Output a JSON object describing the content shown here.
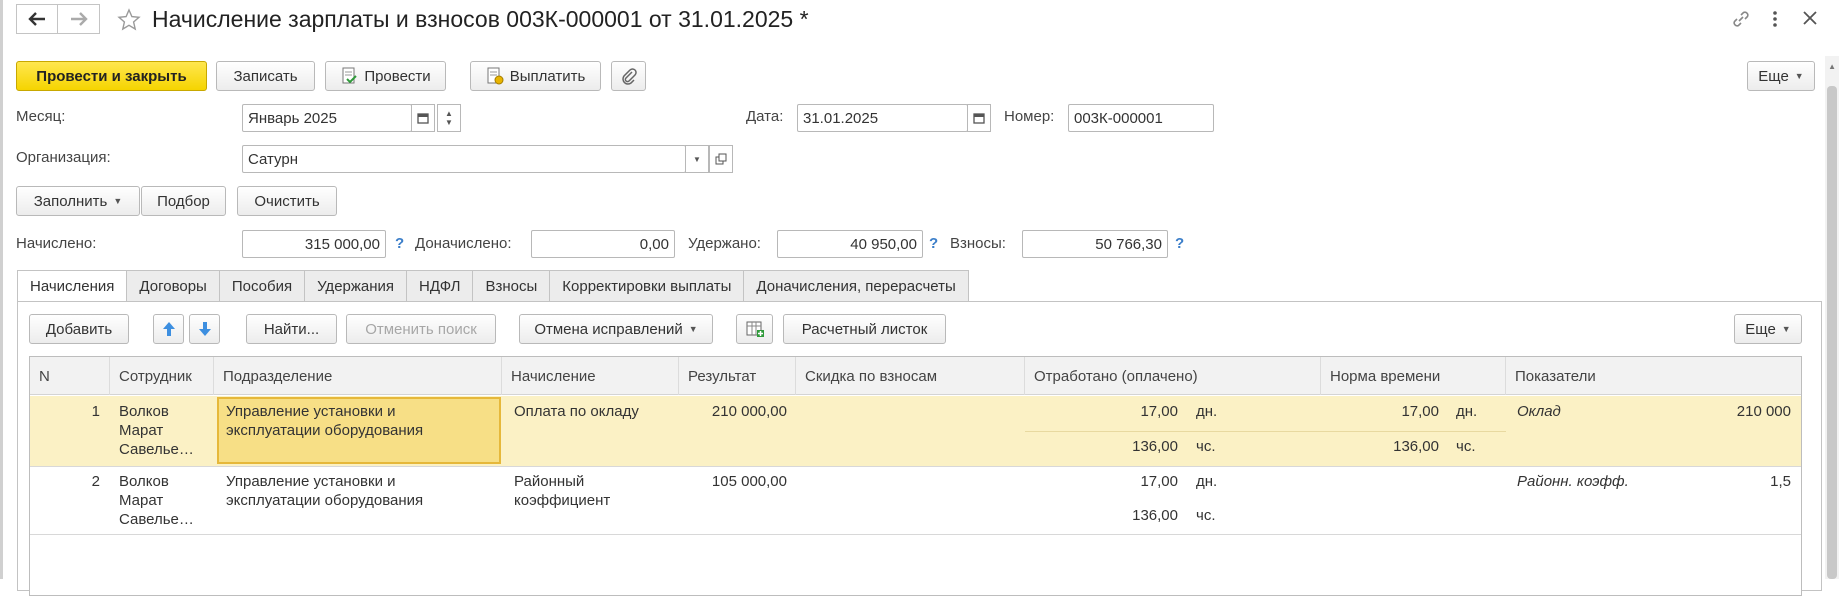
{
  "header": {
    "title": "Начисление зарплаты и взносов 003К-000001 от 31.01.2025 *"
  },
  "toolbar": {
    "post_close": "Провести и закрыть",
    "save": "Записать",
    "post": "Провести",
    "pay": "Выплатить",
    "more": "Еще"
  },
  "form": {
    "month_label": "Месяц:",
    "month_value": "Январь 2025",
    "date_label": "Дата:",
    "date_value": "31.01.2025",
    "number_label": "Номер:",
    "number_value": "003К-000001",
    "org_label": "Организация:",
    "org_value": "Сатурн"
  },
  "actions": {
    "fill": "Заполнить",
    "pick": "Подбор",
    "clear": "Очистить"
  },
  "totals": {
    "accrued_label": "Начислено:",
    "accrued_value": "315 000,00",
    "extra_label": "Доначислено:",
    "extra_value": "0,00",
    "withheld_label": "Удержано:",
    "withheld_value": "40 950,00",
    "contrib_label": "Взносы:",
    "contrib_value": "50 766,30",
    "help": "?"
  },
  "tabs": [
    "Начисления",
    "Договоры",
    "Пособия",
    "Удержания",
    "НДФЛ",
    "Взносы",
    "Корректировки выплаты",
    "Доначисления, перерасчеты"
  ],
  "table_toolbar": {
    "add": "Добавить",
    "find": "Найти...",
    "cancel_search": "Отменить поиск",
    "cancel_fix": "Отмена исправлений",
    "payslip": "Расчетный листок",
    "more": "Еще"
  },
  "table": {
    "columns": [
      "N",
      "Сотрудник",
      "Подразделение",
      "Начисление",
      "Результат",
      "Скидка по взносам",
      "Отработано (оплачено)",
      "Норма времени",
      "Показатели"
    ],
    "rows": [
      {
        "n": "1",
        "employee": [
          "Волков",
          "Марат",
          "Савелье…"
        ],
        "department": [
          "Управление установки и",
          "эксплуатации оборудования"
        ],
        "accrual": [
          "Оплата по окладу"
        ],
        "result": "210 000,00",
        "worked_days": "17,00",
        "days_unit": "дн.",
        "worked_hours": "136,00",
        "hours_unit": "чс.",
        "norm_days": "17,00",
        "norm_days_unit": "дн.",
        "norm_hours": "136,00",
        "norm_hours_unit": "чс.",
        "indicator": "Оклад",
        "indicator_value": "210 000"
      },
      {
        "n": "2",
        "employee": [
          "Волков",
          "Марат",
          "Савелье…"
        ],
        "department": [
          "Управление установки и",
          "эксплуатации оборудования"
        ],
        "accrual": [
          "Районный",
          "коэффициент"
        ],
        "result": "105 000,00",
        "worked_days": "17,00",
        "days_unit": "дн.",
        "worked_hours": "136,00",
        "hours_unit": "чс.",
        "indicator": "Районн. коэфф.",
        "indicator_value": "1,5"
      }
    ]
  }
}
